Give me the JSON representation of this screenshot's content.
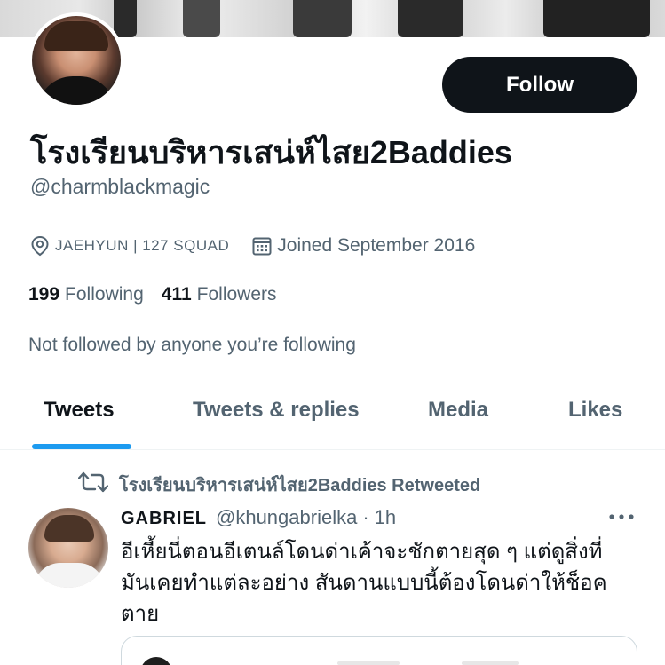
{
  "profile": {
    "display_name": "โรงเรียนบริหารเสน่ห์ไสย2Baddies",
    "handle": "@charmblackmagic",
    "follow_label": "Follow",
    "location": "JAEHYUN | 127 SQUAD",
    "joined": "Joined September 2016",
    "following_count": "199",
    "following_label": "Following",
    "followers_count": "411",
    "followers_label": "Followers",
    "not_followed_text": "Not followed by anyone you’re following",
    "icons": {
      "location": "location-pin-icon",
      "calendar": "calendar-icon"
    }
  },
  "tabs": [
    {
      "label": "Tweets",
      "active": true
    },
    {
      "label": "Tweets & replies",
      "active": false
    },
    {
      "label": "Media",
      "active": false
    },
    {
      "label": "Likes",
      "active": false
    }
  ],
  "timeline": {
    "retweet_label": "โรงเรียนบริหารเสน่ห์ไสย2Baddies Retweeted",
    "tweet": {
      "author": "GABRIEL",
      "handle": "@khungabrielka",
      "separator": "·",
      "time": "1h",
      "text_lines": [
        "อีเหี้ยนี่ตอนอีเตนล์โดนด่าเค้าจะชักตายสุด ๆ แต่ดูสิ่งที่",
        "มันเคยทำแต่ละอย่าง สันดานแบบนี้ต้องโดนด่าให้ช็อค",
        "ตาย"
      ]
    }
  },
  "colors": {
    "accent": "#1d9bf0",
    "text_primary": "#0f1419",
    "text_secondary": "#536471",
    "follow_button_bg": "#0f1419"
  }
}
